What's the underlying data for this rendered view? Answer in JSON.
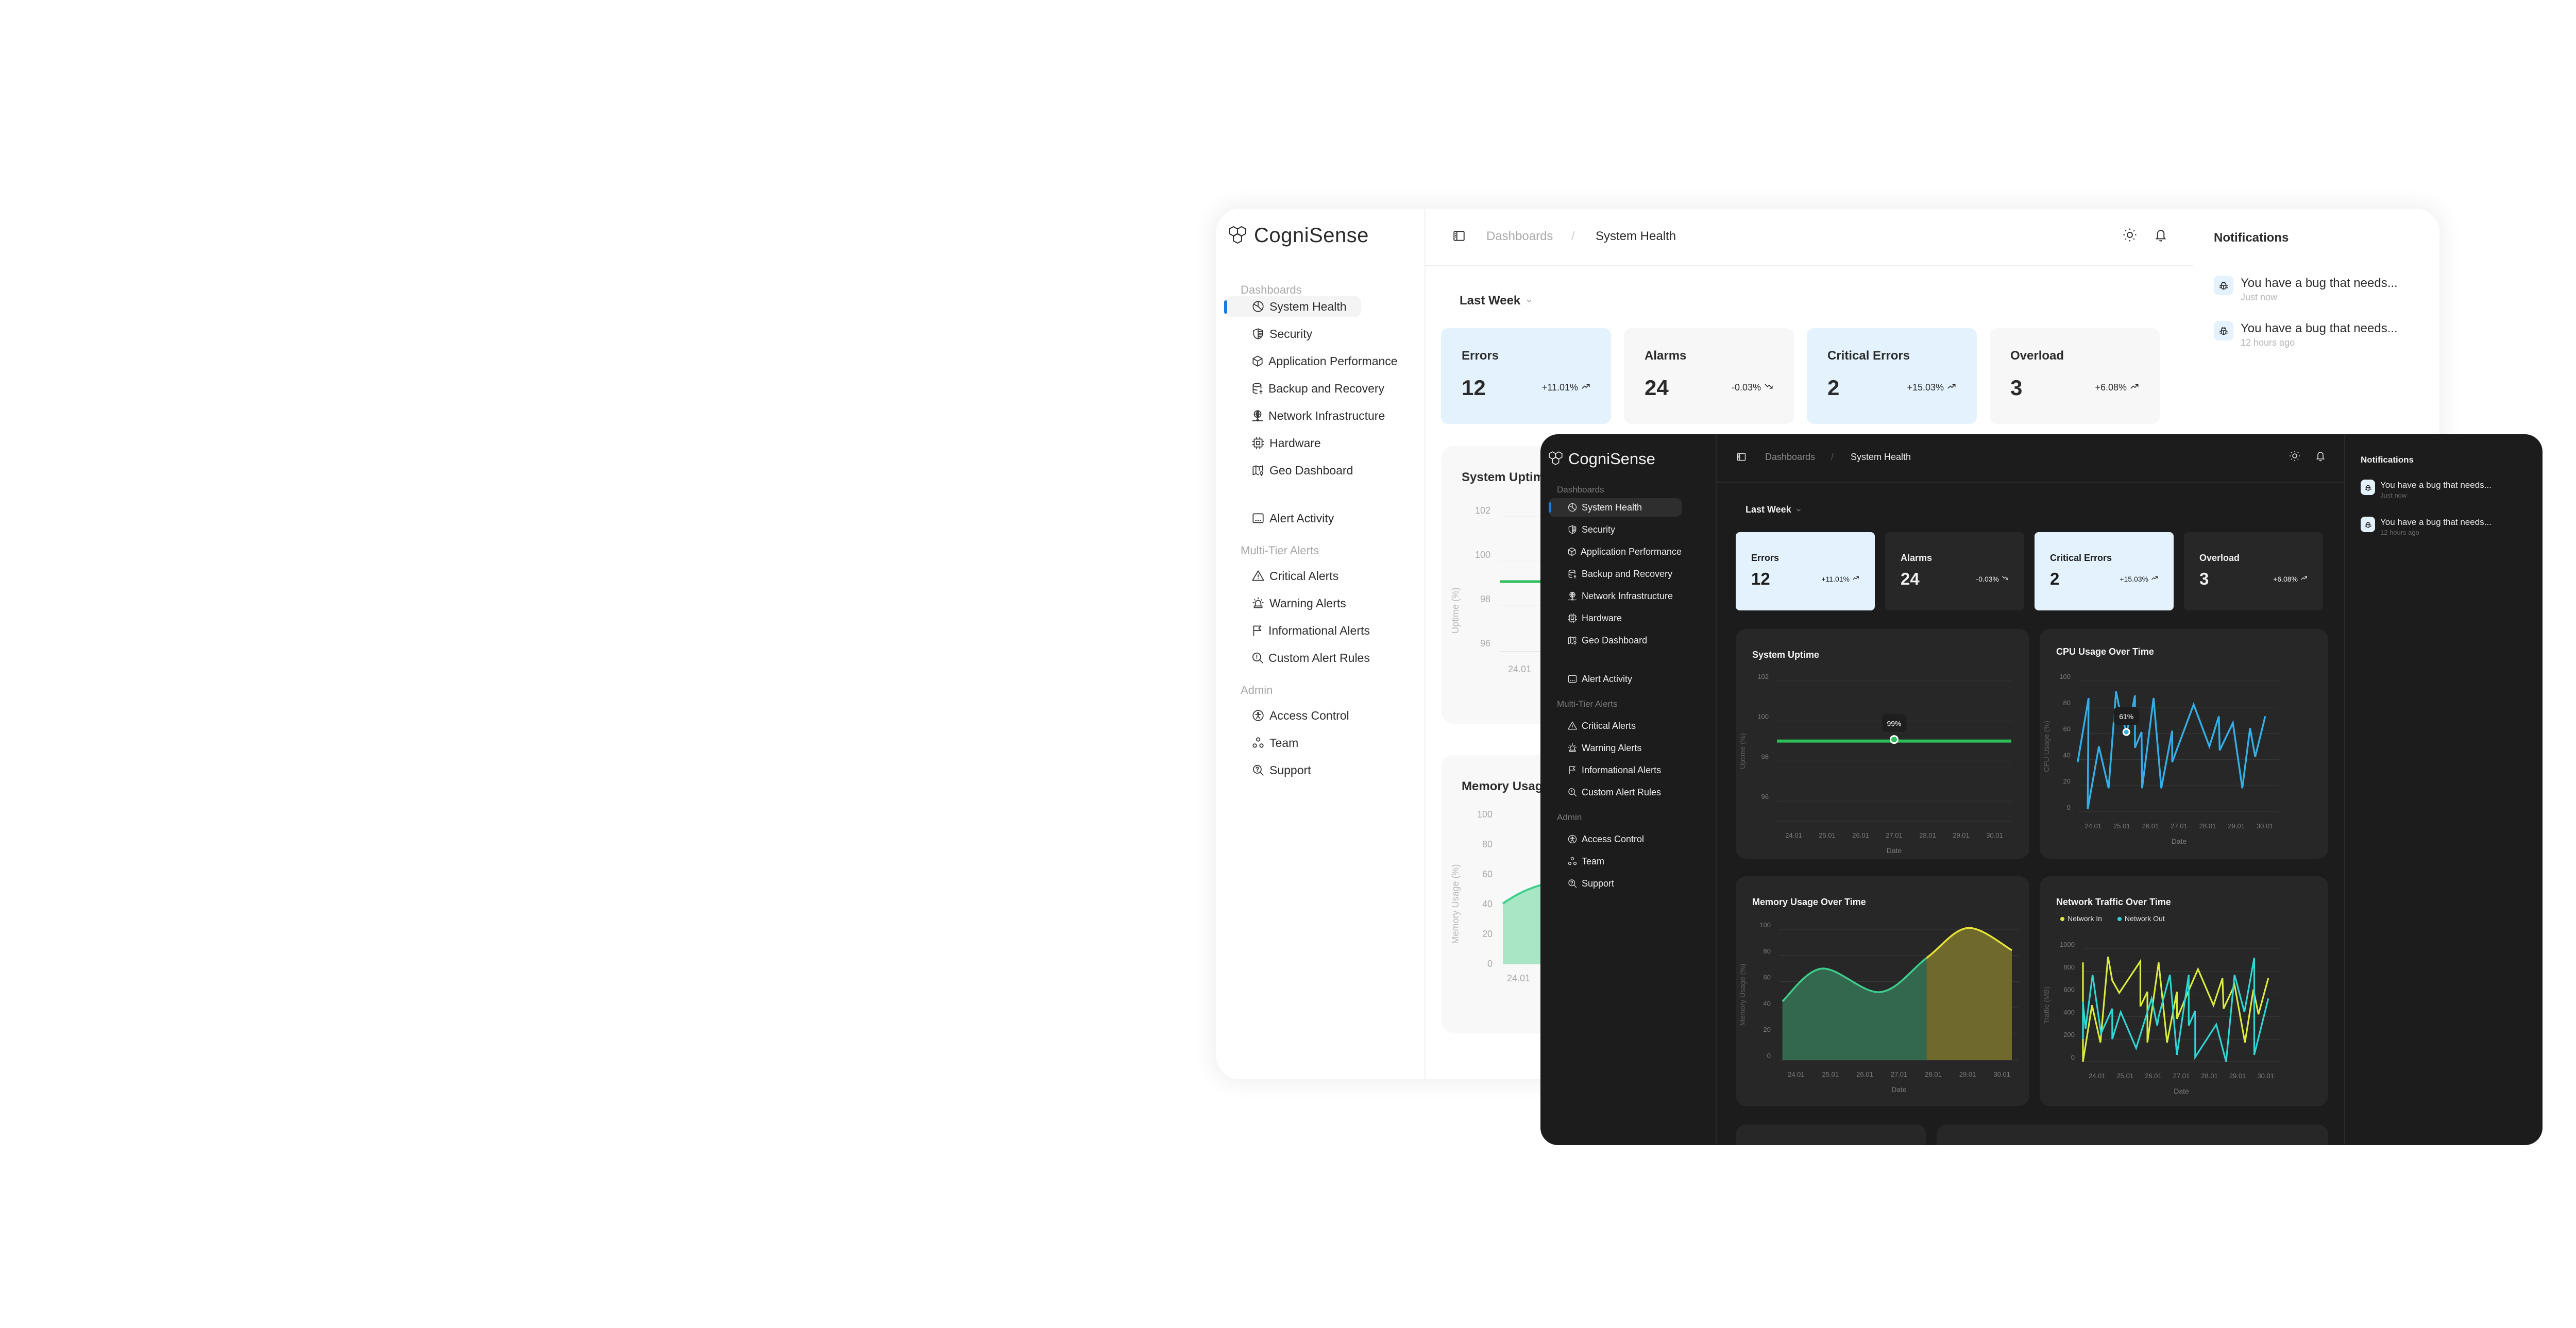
{
  "app": {
    "name": "CogniSense"
  },
  "sidebar": {
    "sections": [
      {
        "label": "Dashboards",
        "items": [
          {
            "label": "System Health",
            "icon": "pie-chart-icon",
            "active": true
          },
          {
            "label": "Security",
            "icon": "shield-icon"
          },
          {
            "label": "Application Performance",
            "icon": "cube-icon"
          },
          {
            "label": "Backup and Recovery",
            "icon": "database-upload-icon"
          },
          {
            "label": "Network Infrastructure",
            "icon": "globe-network-icon"
          },
          {
            "label": "Hardware",
            "icon": "cpu-chip-icon"
          },
          {
            "label": "Geo Dashboard",
            "icon": "map-pin-icon"
          }
        ]
      },
      {
        "label": "",
        "items": [
          {
            "label": "Alert Activity",
            "icon": "message-dots-icon"
          }
        ]
      },
      {
        "label": "Multi-Tier Alerts",
        "items": [
          {
            "label": "Critical Alerts",
            "icon": "warning-triangle-icon"
          },
          {
            "label": "Warning Alerts",
            "icon": "siren-icon"
          },
          {
            "label": "Informational Alerts",
            "icon": "flag-icon"
          },
          {
            "label": "Custom Alert Rules",
            "icon": "search-alert-icon"
          }
        ]
      },
      {
        "label": "Admin",
        "items": [
          {
            "label": "Access Control",
            "icon": "accessibility-icon"
          },
          {
            "label": "Team",
            "icon": "team-icon"
          },
          {
            "label": "Support",
            "icon": "search-help-icon"
          }
        ]
      }
    ]
  },
  "header": {
    "breadcrumb": [
      "Dashboards",
      "System Health"
    ],
    "separator": "/",
    "icons": [
      "sidebar-toggle-icon",
      "sun-icon",
      "bell-icon"
    ]
  },
  "filters": {
    "range": "Last Week"
  },
  "stats": [
    {
      "title": "Errors",
      "value": "12",
      "delta": "+11.01%",
      "trend": "up",
      "highlight": true
    },
    {
      "title": "Alarms",
      "value": "24",
      "delta": "-0.03%",
      "trend": "down",
      "highlight": false
    },
    {
      "title": "Critical Errors",
      "value": "2",
      "delta": "+15.03%",
      "trend": "up",
      "highlight": true
    },
    {
      "title": "Overload",
      "value": "3",
      "delta": "+6.08%",
      "trend": "up",
      "highlight": false
    }
  ],
  "notifications": {
    "title": "Notifications",
    "items": [
      {
        "text": "You have a bug that needs...",
        "time": "Just now",
        "icon": "bug-icon"
      },
      {
        "text": "You have a bug that needs...",
        "time": "12 hours ago",
        "icon": "bug-icon"
      }
    ]
  },
  "colors": {
    "accent": "#1f7ae0",
    "highlight_card": "#e3f2fd",
    "uptime_line": "#2ebd59",
    "cpu_line": "#33aee6",
    "memory_green": "#3ecf8e",
    "memory_yellow": "#e6e337",
    "network_in": "#d9ec3a",
    "network_out": "#2ed6d6"
  },
  "chart_data": [
    {
      "id": "uptime",
      "type": "line",
      "title": "System Uptime",
      "xlabel": "Date",
      "ylabel": "Uptime (%)",
      "categories": [
        "24.01",
        "25.01",
        "26.01",
        "27.01",
        "28.01",
        "29.01",
        "30.01"
      ],
      "yticks": [
        96,
        98,
        100,
        102
      ],
      "ylim": [
        95,
        102
      ],
      "series": [
        {
          "name": "Uptime",
          "values": [
            99,
            99,
            99,
            99,
            99,
            99,
            99
          ]
        }
      ],
      "tooltip": {
        "label": "99%",
        "index": 3
      },
      "grid": true
    },
    {
      "id": "cpu",
      "type": "line",
      "title": "CPU Usage Over Time",
      "xlabel": "Date",
      "ylabel": "CPU Usage (%)",
      "categories": [
        "24.01",
        "25.01",
        "26.01",
        "27.01",
        "28.01",
        "29.01",
        "30.01"
      ],
      "yticks": [
        0,
        20,
        40,
        60,
        80,
        100
      ],
      "ylim": [
        0,
        100
      ],
      "series": [
        {
          "name": "CPU Usage",
          "x": [
            0,
            0.38,
            0.35,
            0.74,
            1.08,
            1.34,
            1.45,
            1.7,
            1.85,
            2.0,
            2.0,
            2.23,
            2.25,
            2.65,
            2.92,
            3.3,
            3.3,
            4.05,
            4.6,
            4.93,
            4.96,
            5.42,
            5.75,
            6.02,
            6.2,
            6.55
          ],
          "values": [
            38,
            87,
            2,
            50,
            18,
            92,
            80,
            61,
            72,
            89,
            49,
            61,
            18,
            87,
            18,
            62,
            38,
            82,
            50,
            73,
            47,
            68,
            18,
            64,
            42,
            73
          ]
        }
      ],
      "tooltip": {
        "label": "61%",
        "index": 7
      },
      "grid": true
    },
    {
      "id": "memory",
      "type": "area",
      "title": "Memory Usage Over Time",
      "xlabel": "Date",
      "ylabel": "Memory Usage (%)",
      "categories": [
        "24.01",
        "25.01",
        "26.01",
        "27.01",
        "28.01",
        "29.01",
        "30.01"
      ],
      "yticks": [
        0,
        20,
        40,
        60,
        80,
        100
      ],
      "ylim": [
        0,
        100
      ],
      "series": [
        {
          "name": "Memory Usage",
          "x": [
            -0.4,
            0.75,
            2.45,
            3.8,
            5.0,
            6.5
          ],
          "values": [
            45,
            70,
            52,
            78,
            101,
            84
          ]
        }
      ],
      "threshold": {
        "x": 3.8,
        "below_color": "green",
        "above_color": "yellow"
      },
      "grid": true
    },
    {
      "id": "network",
      "type": "line",
      "title": "Network Traffic Over Time",
      "xlabel": "Date",
      "ylabel": "Traffic (MB)",
      "categories": [
        "24.01",
        "25.01",
        "26.01",
        "27.01",
        "28.01",
        "29.01",
        "30.01"
      ],
      "yticks": [
        0,
        200,
        400,
        600,
        800,
        1000
      ],
      "ylim": [
        0,
        1000
      ],
      "legend": "top-left",
      "series": [
        {
          "name": "Network In",
          "x": [
            -0.45,
            -0.15,
            -0.1,
            0.28,
            0.58,
            0.85,
            1.0,
            1.25,
            2.0,
            2.0,
            2.25,
            2.25,
            2.65,
            2.95,
            3.3,
            3.3,
            3.7,
            4.05,
            4.6,
            4.92,
            4.96,
            5.35,
            5.72,
            6.02,
            6.2,
            6.55
          ],
          "values": [
            380,
            880,
            0,
            500,
            170,
            930,
            720,
            610,
            890,
            490,
            620,
            170,
            880,
            170,
            620,
            380,
            620,
            820,
            500,
            740,
            470,
            680,
            170,
            640,
            420,
            740
          ]
        },
        {
          "name": "Network Out",
          "x": [
            -0.45,
            -0.2,
            0.05,
            0.3,
            0.6,
            1.0,
            1.0,
            1.3,
            1.85,
            2.4,
            2.6,
            2.65,
            3.05,
            3.3,
            3.72,
            3.72,
            3.95,
            3.95,
            4.7,
            5.05,
            5.35,
            5.7,
            6.05,
            6.05,
            6.55
          ],
          "values": [
            200,
            530,
            290,
            770,
            250,
            470,
            200,
            440,
            120,
            560,
            320,
            400,
            770,
            60,
            770,
            320,
            450,
            40,
            330,
            0,
            770,
            440,
            920,
            60,
            560
          ]
        }
      ],
      "grid": true
    }
  ],
  "light_partial_charts": [
    {
      "title": "System Uptime",
      "ylabel": "Uptime (%)",
      "yticks": [
        96,
        98,
        100,
        102
      ],
      "first_x": "24.01"
    },
    {
      "title": "Memory Usage Over Time",
      "ylabel": "Memory Usage (%)",
      "yticks": [
        0,
        20,
        40,
        60,
        80,
        100
      ],
      "first_x": "24.01"
    }
  ]
}
